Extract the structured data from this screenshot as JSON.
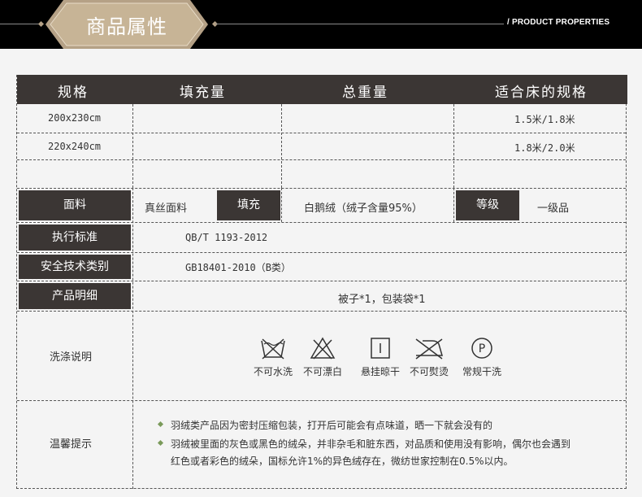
{
  "header": {
    "title": "商品属性",
    "subtitle": "/ PRODUCT PROPERTIES"
  },
  "table_head": [
    "规格",
    "填充量",
    "总重量",
    "适合床的规格"
  ],
  "spec_rows": [
    {
      "size": "200x230cm",
      "fill": "",
      "weight": "",
      "bed": "1.5米/1.8米"
    },
    {
      "size": "220x240cm",
      "fill": "",
      "weight": "",
      "bed": "1.8米/2.0米"
    },
    {
      "size": "",
      "fill": "",
      "weight": "",
      "bed": ""
    }
  ],
  "attrs": {
    "fabric_label": "面料",
    "fabric_value": "真丝面料",
    "filling_label": "填充",
    "filling_value": "白鹅绒（绒子含量95%）",
    "grade_label": "等级",
    "grade_value": "一级品",
    "standard_label": "执行标准",
    "standard_value": "QB/T 1193-2012",
    "safety_label": "安全技术类别",
    "safety_value": "GB18401-2010（B类）",
    "detail_label": "产品明细",
    "detail_value": "被子*1，包装袋*1",
    "wash_label": "洗涤说明",
    "tips_label": "温馨提示"
  },
  "wash_icons": [
    {
      "icon": "no-water-wash-icon",
      "label": "不可水洗"
    },
    {
      "icon": "no-bleach-icon",
      "label": "不可漂白"
    },
    {
      "icon": "hang-dry-icon",
      "label": "悬挂晾干"
    },
    {
      "icon": "no-iron-icon",
      "label": "不可熨烫"
    },
    {
      "icon": "dry-clean-icon",
      "label": "常规干洗"
    }
  ],
  "tips": [
    "羽绒类产品因为密封压缩包装，打开后可能会有点味道，晒一下就会没有的",
    "羽绒被里面的灰色或黑色的绒朵，并非杂毛和脏东西，对品质和使用没有影响，偶尔也会遇到",
    "红色或者彩色的绒朵，国标允许1%的异色绒存在，微纺世家控制在0.5%以内。"
  ],
  "colors": {
    "header_bg": "#000000",
    "label_bg": "#3b3634",
    "badge_gold": "#b5a186",
    "page_bg": "#f4f4f4",
    "bullet": "#7a9a5a"
  }
}
